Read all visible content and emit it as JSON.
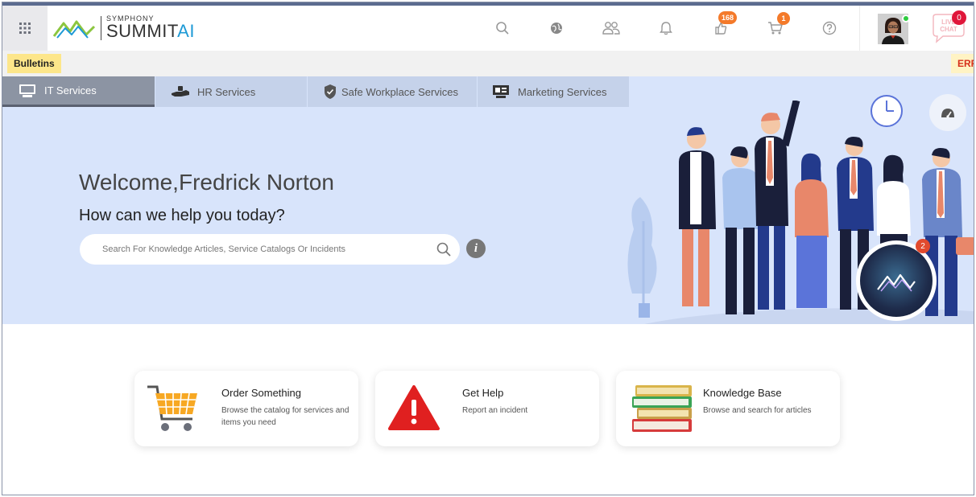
{
  "header": {
    "logo_small": "SYMPHONY",
    "logo_big": "SUMMIT",
    "logo_ai": "AI",
    "notifications_badge": "168",
    "cart_badge": "1",
    "chat_badge": "0",
    "chat_label": "LIVE CHAT",
    "icons": [
      "apps-grid-icon",
      "search-icon",
      "globe-icon",
      "users-icon",
      "bell-icon",
      "approvals-icon",
      "cart-icon",
      "help-icon",
      "chat-icon"
    ]
  },
  "bulletins": {
    "label": "Bulletins",
    "ticker": "ERR"
  },
  "tabs": [
    {
      "label": "IT Services",
      "active": true
    },
    {
      "label": "HR Services",
      "active": false
    },
    {
      "label": "Safe Workplace Services",
      "active": false
    },
    {
      "label": "Marketing Services",
      "active": false
    }
  ],
  "hero": {
    "welcome": "Welcome,Fredrick Norton",
    "subtitle": "How can we help you today?",
    "search_placeholder": "Search For Knowledge Articles, Service Catalogs Or Incidents",
    "info_glyph": "i",
    "bot_badge": "2"
  },
  "cards": [
    {
      "title": "Order Something",
      "desc": "Browse the catalog for services and items you need"
    },
    {
      "title": "Get Help",
      "desc": "Report an incident"
    },
    {
      "title": "Knowledge Base",
      "desc": "Browse and search for articles"
    }
  ],
  "colors": {
    "hero_bg": "#d8e4fb",
    "tab_active": "#8c94a3",
    "badge_orange": "#f47a2a",
    "chat_red": "#e0163a",
    "brand_blue": "#1e9ad6"
  }
}
